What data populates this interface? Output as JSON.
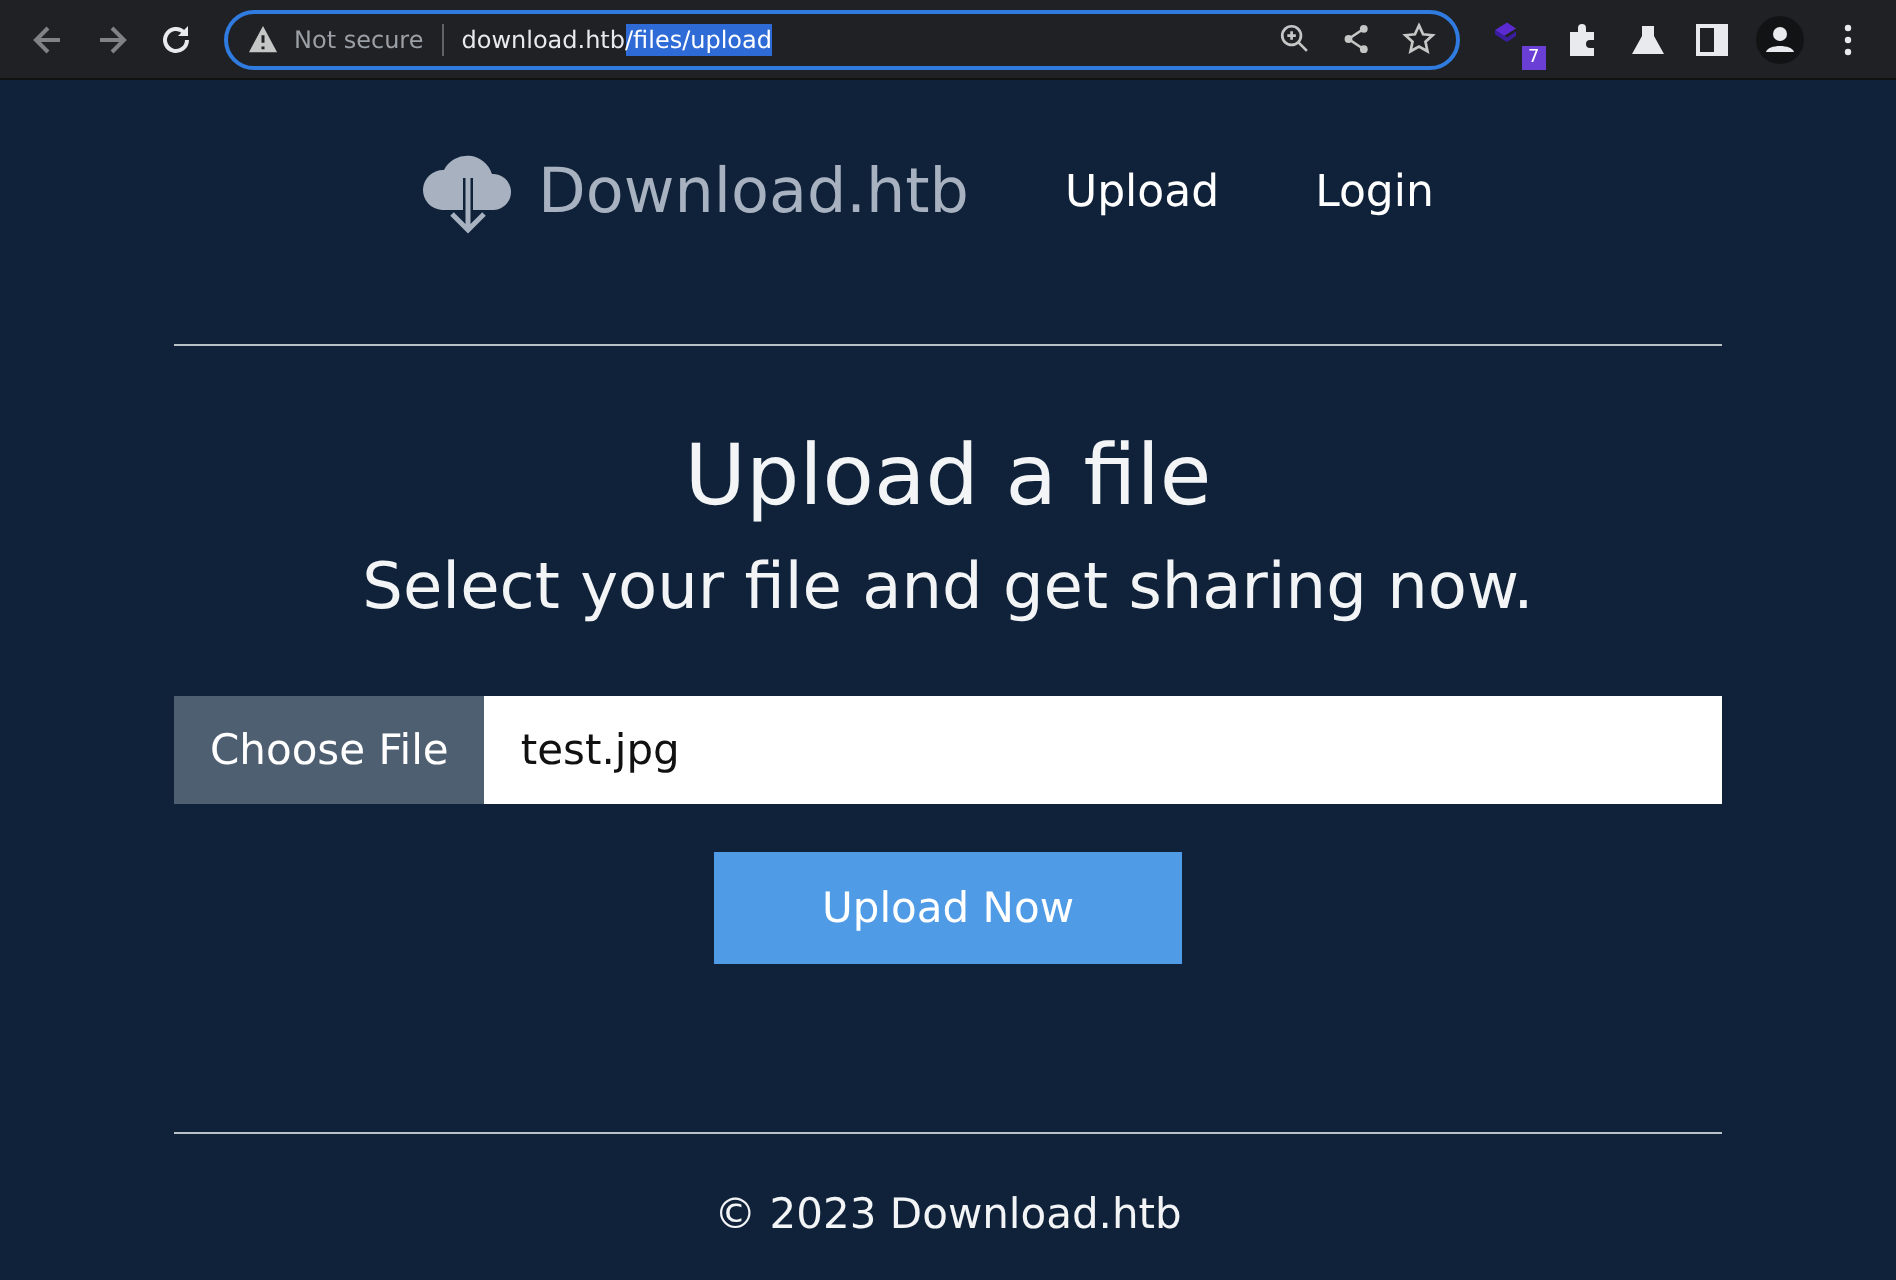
{
  "browser": {
    "security": "Not secure",
    "url_host": "download.htb",
    "url_path": {
      "text": "/files/upload",
      "selected": true
    },
    "extension_badge": "7"
  },
  "nav": {
    "brand": "Download.htb",
    "links": [
      "Upload",
      "Login"
    ]
  },
  "main": {
    "title": "Upload a file",
    "subtitle": "Select your file and get sharing now.",
    "file_button": "Choose File",
    "file_name": "test.jpg",
    "submit": "Upload Now"
  },
  "footer": "© 2023 Download.htb"
}
